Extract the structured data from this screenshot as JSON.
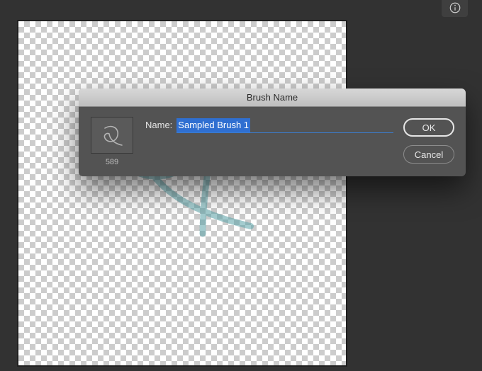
{
  "info_icon": "info",
  "dialog": {
    "title": "Brush Name",
    "name_label": "Name:",
    "name_value": "Sampled Brush 1",
    "thumb_size": "589",
    "ok_label": "OK",
    "cancel_label": "Cancel"
  },
  "colors": {
    "stroke": "#5aa3a7",
    "dialog_bg": "#535353",
    "select_bg": "#2f6fd1"
  }
}
